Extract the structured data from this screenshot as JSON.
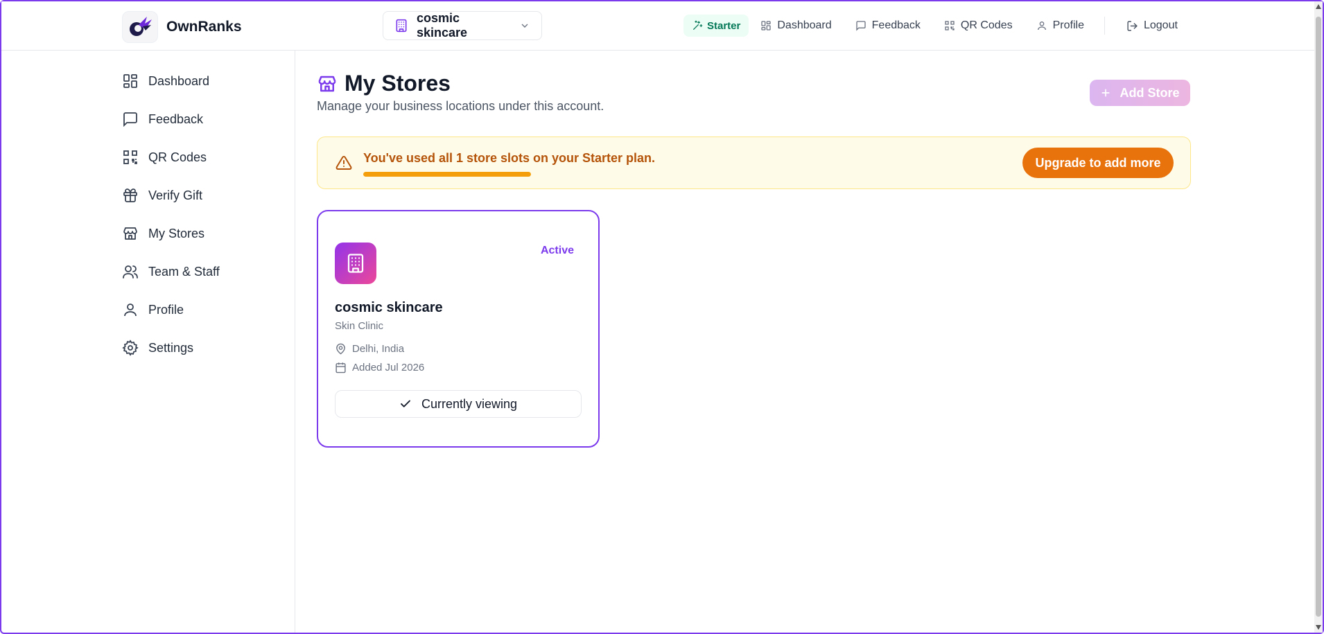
{
  "header": {
    "brand_name": "OwnRanks",
    "store_selector": "cosmic skincare",
    "plan_badge": "Starter",
    "nav": {
      "dashboard": "Dashboard",
      "feedback": "Feedback",
      "qr_codes": "QR Codes",
      "profile": "Profile",
      "logout": "Logout"
    }
  },
  "sidebar": {
    "items": [
      {
        "label": "Dashboard",
        "icon": "dashboard-icon"
      },
      {
        "label": "Feedback",
        "icon": "message-icon"
      },
      {
        "label": "QR Codes",
        "icon": "qr-code-icon"
      },
      {
        "label": "Verify Gift",
        "icon": "gift-icon"
      },
      {
        "label": "My Stores",
        "icon": "store-icon"
      },
      {
        "label": "Team & Staff",
        "icon": "users-icon"
      },
      {
        "label": "Profile",
        "icon": "user-icon"
      },
      {
        "label": "Settings",
        "icon": "gear-icon"
      }
    ]
  },
  "page": {
    "title": "My Stores",
    "subtitle": "Manage your business locations under this account.",
    "add_store_label": "Add Store"
  },
  "alert": {
    "message": "You've used all 1 store slots on your Starter plan.",
    "usage_percent": 100,
    "upgrade_label": "Upgrade to add more"
  },
  "stores": [
    {
      "name": "cosmic skincare",
      "type": "Skin Clinic",
      "status": "Active",
      "location": "Delhi, India",
      "added": "Added Jul 2026",
      "action_label": "Currently viewing"
    }
  ],
  "colors": {
    "accent": "#7c3aed",
    "warning": "#b45309",
    "upgrade": "#e8720c",
    "plan_badge": "#047857"
  }
}
